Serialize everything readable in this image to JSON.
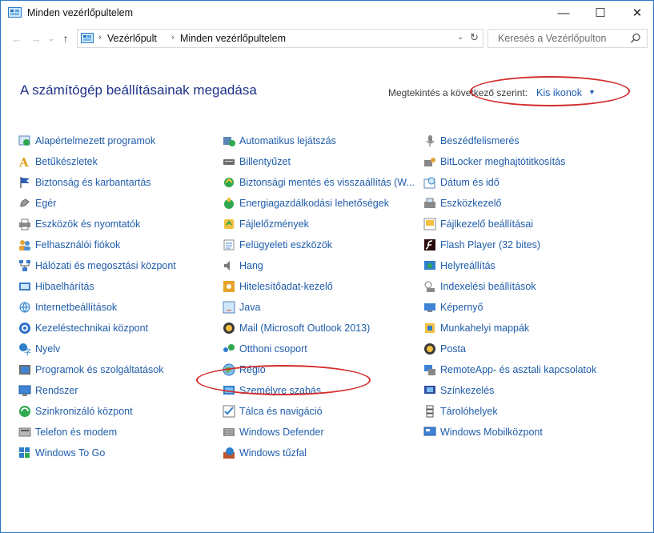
{
  "window": {
    "title": "Minden vezérlőpultelem"
  },
  "caption": {
    "minimize": "—",
    "maximize": "☐",
    "close": "✕"
  },
  "nav": {
    "back": "←",
    "forward": "→",
    "recent": "⌄",
    "up": "↑"
  },
  "address": {
    "separator": "›",
    "crumbs": [
      "Vezérlőpult",
      "Minden vezérlőpultelem"
    ],
    "dropdown": "⌄",
    "refresh": "↻"
  },
  "search": {
    "placeholder": "Keresés a Vezérlőpulton"
  },
  "header": {
    "title": "A számítógép beállításainak megadása",
    "view_label": "Megtekintés a következő szerint:",
    "view_value": "Kis ikonok",
    "view_caret": "▼"
  },
  "accent": {
    "link": "#1f5ca9",
    "title": "#1e3287",
    "annotation": "#d42b2b"
  },
  "columns": [
    [
      {
        "label": "Alapértelmezett programok",
        "icon": "default-programs-icon"
      },
      {
        "label": "Betűkészletek",
        "icon": "fonts-icon"
      },
      {
        "label": "Biztonság és karbantartás",
        "icon": "flag-icon"
      },
      {
        "label": "Egér",
        "icon": "mouse-icon"
      },
      {
        "label": "Eszközök és nyomtatók",
        "icon": "printer-icon"
      },
      {
        "label": "Felhasználói fiókok",
        "icon": "users-icon"
      },
      {
        "label": "Hálózati és megosztási központ",
        "icon": "network-icon"
      },
      {
        "label": "Hibaelhárítás",
        "icon": "troubleshoot-icon"
      },
      {
        "label": "Internetbeállítások",
        "icon": "internet-options-icon"
      },
      {
        "label": "Kezeléstechnikai központ",
        "icon": "ease-of-access-icon"
      },
      {
        "label": "Nyelv",
        "icon": "language-icon"
      },
      {
        "label": "Programok és szolgáltatások",
        "icon": "programs-icon"
      },
      {
        "label": "Rendszer",
        "icon": "system-icon"
      },
      {
        "label": "Szinkronizáló központ",
        "icon": "sync-icon"
      },
      {
        "label": "Telefon és modem",
        "icon": "phone-modem-icon"
      },
      {
        "label": "Windows To Go",
        "icon": "windows-to-go-icon"
      }
    ],
    [
      {
        "label": "Automatikus lejátszás",
        "icon": "autoplay-icon"
      },
      {
        "label": "Billentyűzet",
        "icon": "keyboard-icon"
      },
      {
        "label": "Biztonsági mentés és visszaállítás (W...",
        "icon": "backup-icon"
      },
      {
        "label": "Energiagazdálkodási lehetőségek",
        "icon": "power-icon"
      },
      {
        "label": "Fájlelőzmények",
        "icon": "file-history-icon"
      },
      {
        "label": "Felügyeleti eszközök",
        "icon": "admin-tools-icon"
      },
      {
        "label": "Hang",
        "icon": "sound-icon"
      },
      {
        "label": "Hitelesítőadat-kezelő",
        "icon": "credential-icon"
      },
      {
        "label": "Java",
        "icon": "java-icon"
      },
      {
        "label": "Mail (Microsoft Outlook 2013)",
        "icon": "mail-icon"
      },
      {
        "label": "Otthoni csoport",
        "icon": "homegroup-icon"
      },
      {
        "label": "Régió",
        "icon": "region-icon"
      },
      {
        "label": "Személyre szabás",
        "icon": "personalization-icon"
      },
      {
        "label": "Tálca és navigáció",
        "icon": "taskbar-icon"
      },
      {
        "label": "Windows Defender",
        "icon": "defender-icon"
      },
      {
        "label": "Windows tűzfal",
        "icon": "firewall-icon"
      }
    ],
    [
      {
        "label": "Beszédfelismerés",
        "icon": "microphone-icon"
      },
      {
        "label": "BitLocker meghajtótitkosítás",
        "icon": "bitlocker-icon"
      },
      {
        "label": "Dátum és idő",
        "icon": "clock-icon"
      },
      {
        "label": "Eszközkezelő",
        "icon": "device-manager-icon"
      },
      {
        "label": "Fájlkezelő beállításai",
        "icon": "folder-options-icon"
      },
      {
        "label": "Flash Player (32 bites)",
        "icon": "flash-icon"
      },
      {
        "label": "Helyreállítás",
        "icon": "recovery-icon"
      },
      {
        "label": "Indexelési beállítások",
        "icon": "indexing-icon"
      },
      {
        "label": "Képernyő",
        "icon": "display-icon"
      },
      {
        "label": "Munkahelyi mappák",
        "icon": "work-folders-icon"
      },
      {
        "label": "Posta",
        "icon": "post-icon"
      },
      {
        "label": "RemoteApp- és asztali kapcsolatok",
        "icon": "remoteapp-icon"
      },
      {
        "label": "Színkezelés",
        "icon": "color-management-icon"
      },
      {
        "label": "Tárolóhelyek",
        "icon": "storage-spaces-icon"
      },
      {
        "label": "Windows Mobilközpont",
        "icon": "mobility-center-icon"
      }
    ]
  ]
}
